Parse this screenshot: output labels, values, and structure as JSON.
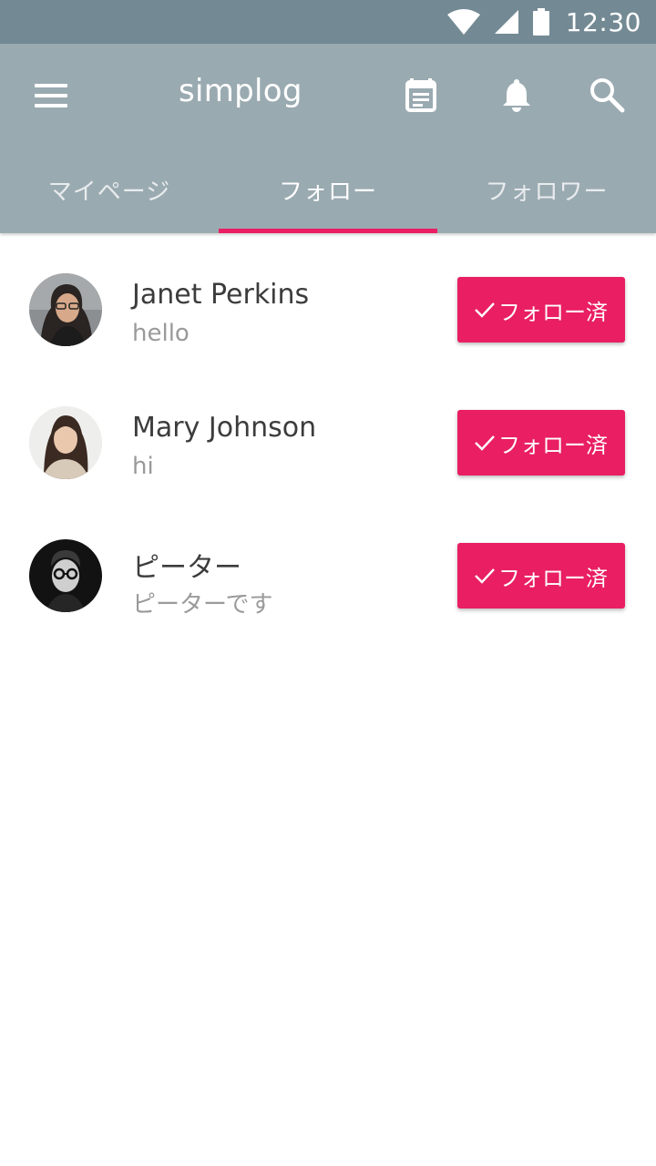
{
  "status_bar": {
    "time": "12:30",
    "icons": [
      "wifi-icon",
      "cell-signal-icon",
      "battery-icon"
    ]
  },
  "toolbar": {
    "title": "simplog",
    "icons": [
      "menu-icon",
      "calendar-icon",
      "bell-icon",
      "search-icon"
    ]
  },
  "tabs": [
    {
      "label": "マイページ",
      "active": false
    },
    {
      "label": "フォロー",
      "active": true
    },
    {
      "label": "フォロワー",
      "active": false
    }
  ],
  "follows": [
    {
      "name": "Janet Perkins",
      "message": "hello",
      "button_label": "フォロー済",
      "button_icon": "check-icon"
    },
    {
      "name": "Mary Johnson",
      "message": "hi",
      "button_label": "フォロー済",
      "button_icon": "check-icon"
    },
    {
      "name": "ピーター",
      "message": "ピーターです",
      "button_label": "フォロー済",
      "button_icon": "check-icon"
    }
  ],
  "colors": {
    "status_bar": "#738a94",
    "app_bar": "#9aaab1",
    "accent": "#e91e63"
  }
}
